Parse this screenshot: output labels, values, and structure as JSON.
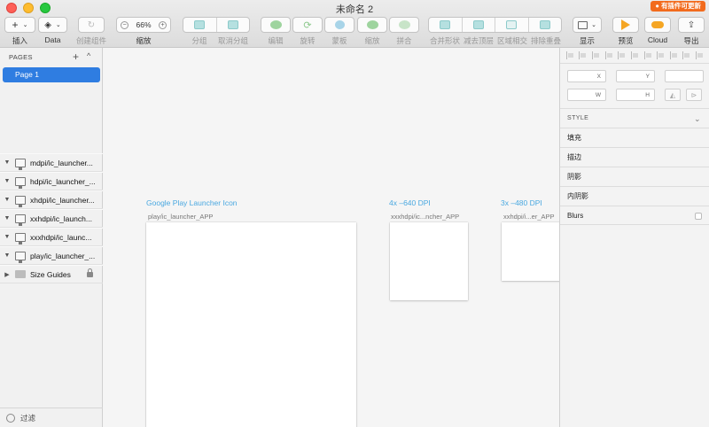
{
  "window": {
    "title": "未命名 2",
    "update_badge": "● 有插件可更新"
  },
  "toolbar": {
    "insert": "插入",
    "data": "Data",
    "create_component": "创建组件",
    "zoom_label": "缩放",
    "zoom_minus": "−",
    "zoom_value": "66%",
    "zoom_plus": "+",
    "group": "分组",
    "ungroup": "取消分组",
    "edit": "编辑",
    "rotate": "旋转",
    "mask": "蒙板",
    "scale": "缩放",
    "flatten": "拼合",
    "union": "合并形状",
    "subtract": "减去顶层",
    "intersect": "区域相交",
    "difference": "排除重叠",
    "view": "显示",
    "preview": "预览",
    "cloud": "Cloud",
    "export": "导出"
  },
  "sidebar": {
    "pages_title": "PAGES",
    "add": "+",
    "collapse": "^",
    "pages": [
      "Page 1"
    ],
    "layers": [
      {
        "name": "mdpi/ic_launcher..."
      },
      {
        "name": "hdpi/ic_launcher_..."
      },
      {
        "name": "xhdpi/ic_launcher..."
      },
      {
        "name": "xxhdpi/ic_launch..."
      },
      {
        "name": "xxxhdpi/ic_launc..."
      },
      {
        "name": "play/ic_launcher_..."
      },
      {
        "name": "Size Guides"
      }
    ],
    "filter": "过滤"
  },
  "canvas": {
    "artboards": [
      {
        "title": "Google Play Launcher Icon",
        "subtitle": "play/ic_launcher_APP"
      },
      {
        "title": "4x –640 DPI",
        "subtitle": "xxxhdpi/ic...ncher_APP"
      },
      {
        "title": "3x –480 DPI",
        "subtitle": "xxhdpi/i...er_APP"
      }
    ]
  },
  "inspector": {
    "x_label": "X",
    "y_label": "Y",
    "w_label": "W",
    "h_label": "H",
    "style_header": "STYLE",
    "fills": "填充",
    "borders": "描边",
    "shadows": "阴影",
    "inner_shadows": "内阴影",
    "blurs": "Blurs"
  }
}
